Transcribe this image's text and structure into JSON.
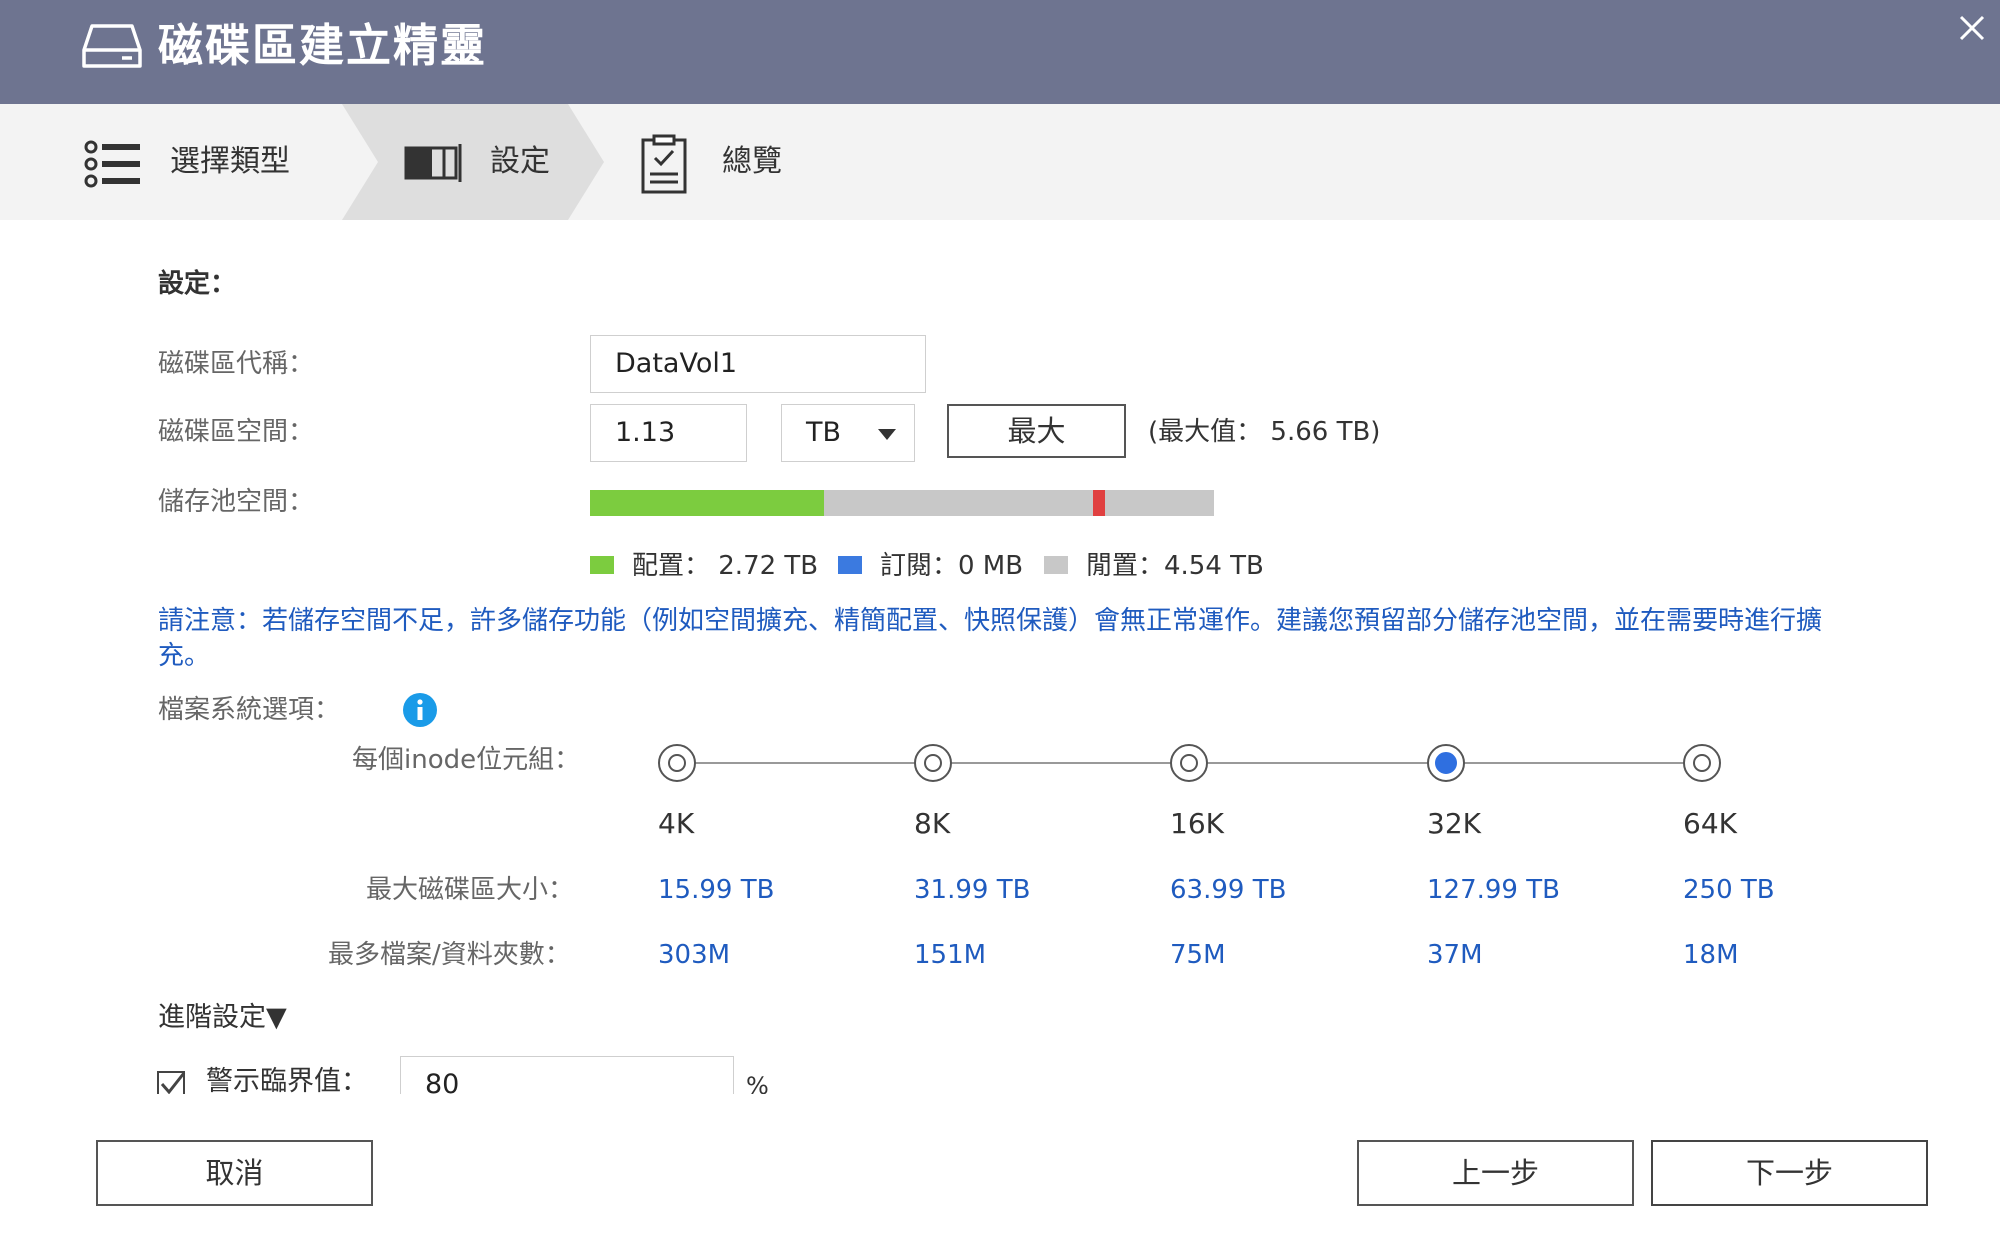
{
  "window": {
    "title": "磁碟區建立精靈",
    "icon": "disk-drive-icon",
    "close_icon": "close-icon"
  },
  "steps": [
    {
      "label": "選擇類型",
      "icon": "list-icon"
    },
    {
      "label": "設定",
      "icon": "storage-bar-icon"
    },
    {
      "label": "總覽",
      "icon": "clipboard-check-icon"
    }
  ],
  "form": {
    "section_title": "設定：",
    "volume_alias": {
      "label": "磁碟區代稱：",
      "value": "DataVol1"
    },
    "volume_capacity": {
      "label": "磁碟區空間：",
      "value": "1.13",
      "unit": "TB",
      "max_button": "最大",
      "max_hint": "(最大值： 5.66 TB)"
    },
    "pool_space": {
      "label": "儲存池空間：",
      "allocated_fraction": 0.375,
      "marker_fraction": 0.806,
      "legend": [
        {
          "label": "配置： 2.72 TB",
          "color": "#7ccc3f"
        },
        {
          "label": "訂閱：0 MB",
          "color": "#3b7ae0"
        },
        {
          "label": "閒置：4.54 TB",
          "color": "#c8c8c8"
        }
      ],
      "marker_color": "#e04040"
    },
    "notice": "請注意：若儲存空間不足，許多儲存功能（例如空間擴充、精簡配置、快照保護）會無正常運作。建議您預留部分儲存池空間，並在需要時進行擴充。",
    "fs_options": {
      "label": "檔案系統選項：",
      "info_icon": "info-icon",
      "inode_label": "每個inode位元組：",
      "options": [
        "4K",
        "8K",
        "16K",
        "32K",
        "64K"
      ],
      "selected": "32K",
      "max_size_label": "最大磁碟區大小：",
      "max_sizes": [
        "15.99 TB",
        "31.99 TB",
        "63.99 TB",
        "127.99 TB",
        "250 TB"
      ],
      "max_files_label": "最多檔案/資料夾數：",
      "max_files": [
        "303M",
        "151M",
        "75M",
        "37M",
        "18M"
      ]
    },
    "advanced": {
      "label": "進階設定▼",
      "alert_threshold": {
        "checked": true,
        "label": "警示臨界值：",
        "value": "80",
        "unit": "%"
      }
    }
  },
  "footer": {
    "cancel": "取消",
    "back": "上一步",
    "next": "下一步"
  },
  "colors": {
    "titlebar": "#6e7490",
    "accent_blue": "#1f5bbf",
    "radio_selected": "#2f6fe0",
    "info_icon": "#1a9be8"
  }
}
